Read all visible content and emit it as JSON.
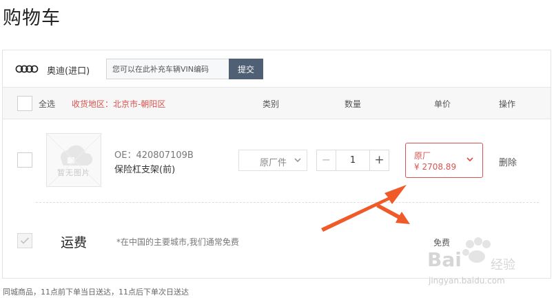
{
  "page": {
    "title": "购物车"
  },
  "brand": {
    "name": "奥迪(进口)",
    "logo_icon": "audi-rings-icon"
  },
  "vin": {
    "placeholder": "您可以在此补充车辆VIN编码",
    "submit_label": "提交"
  },
  "header": {
    "select_all": "全选",
    "region": "收货地区：北京市-朝阳区",
    "columns": {
      "type": "类别",
      "quantity": "数量",
      "price": "单价",
      "operation": "操作"
    }
  },
  "item": {
    "image_placeholder": "暂无图片",
    "oe": "OE：420807109B",
    "name": "保险杠支架(前)",
    "type_selected": "原厂件",
    "quantity": "1",
    "price_label": "原厂",
    "price_value": "¥ 2708.89",
    "delete_label": "删除"
  },
  "shipping": {
    "title": "运费",
    "note": "*在中国的主要城市,我们通常免费",
    "fee": "免费"
  },
  "footer": {
    "note": "同城商品，11点前下单当日送达，11点后下单次日送达"
  },
  "watermark": {
    "brand": "Bai",
    "sub": "经验",
    "url": "jingyan.baidu.com"
  },
  "colors": {
    "accent": "#d9534f",
    "submit_bg": "#4f6075",
    "arrow": "#ef5a28"
  }
}
